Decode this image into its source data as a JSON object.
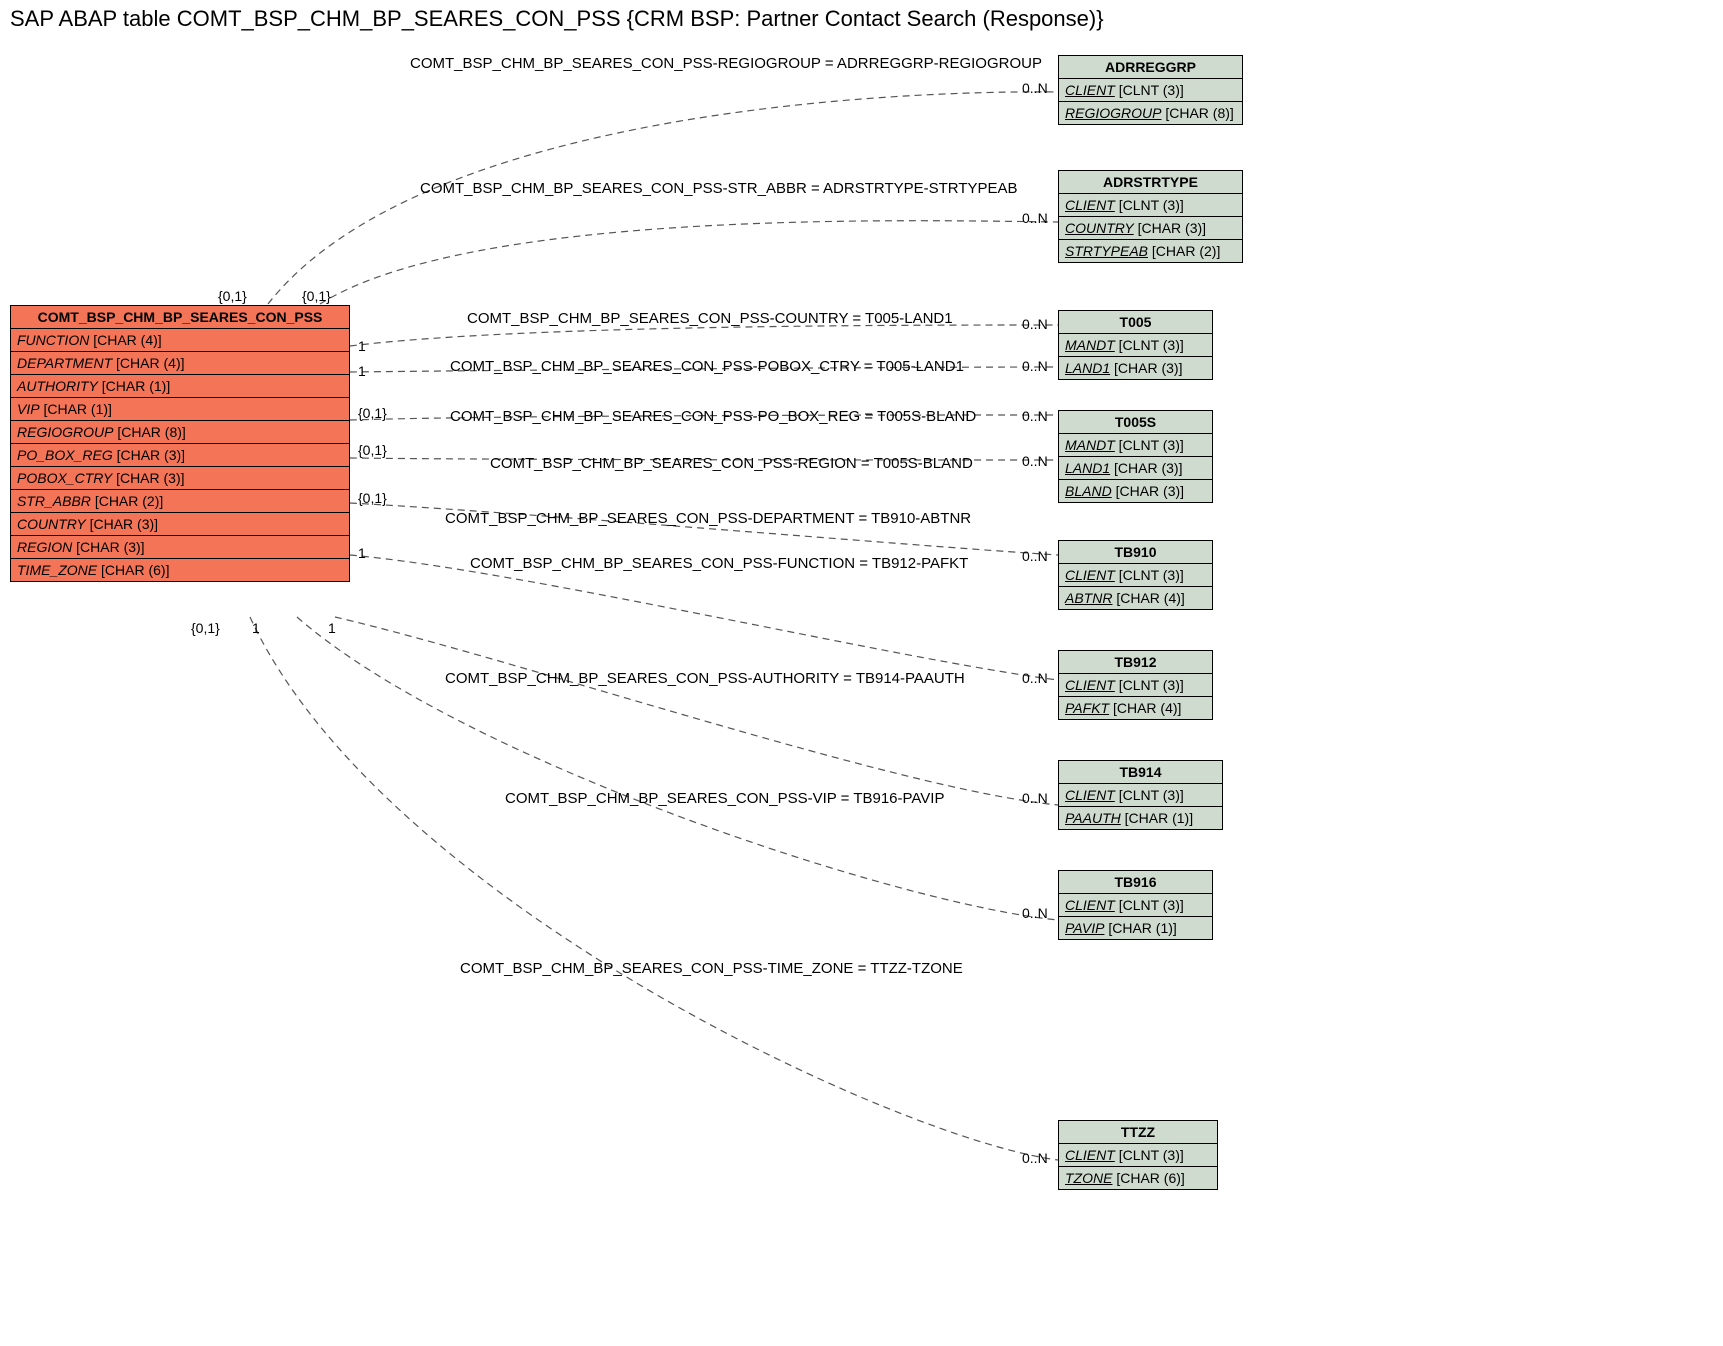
{
  "title": "SAP ABAP table COMT_BSP_CHM_BP_SEARES_CON_PSS {CRM BSP: Partner Contact Search (Response)}",
  "main_entity": {
    "name": "COMT_BSP_CHM_BP_SEARES_CON_PSS",
    "fields": [
      {
        "name": "FUNCTION",
        "type": "[CHAR (4)]"
      },
      {
        "name": "DEPARTMENT",
        "type": "[CHAR (4)]"
      },
      {
        "name": "AUTHORITY",
        "type": "[CHAR (1)]"
      },
      {
        "name": "VIP",
        "type": "[CHAR (1)]"
      },
      {
        "name": "REGIOGROUP",
        "type": "[CHAR (8)]"
      },
      {
        "name": "PO_BOX_REG",
        "type": "[CHAR (3)]"
      },
      {
        "name": "POBOX_CTRY",
        "type": "[CHAR (3)]"
      },
      {
        "name": "STR_ABBR",
        "type": "[CHAR (2)]"
      },
      {
        "name": "COUNTRY",
        "type": "[CHAR (3)]"
      },
      {
        "name": "REGION",
        "type": "[CHAR (3)]"
      },
      {
        "name": "TIME_ZONE",
        "type": "[CHAR (6)]"
      }
    ]
  },
  "target_entities": [
    {
      "id": "adrreggrp",
      "name": "ADRREGGRP",
      "fields": [
        {
          "name": "CLIENT",
          "type": "[CLNT (3)]",
          "ul": true
        },
        {
          "name": "REGIOGROUP",
          "type": "[CHAR (8)]",
          "ul": true
        }
      ]
    },
    {
      "id": "adrstrtype",
      "name": "ADRSTRTYPE",
      "fields": [
        {
          "name": "CLIENT",
          "type": "[CLNT (3)]",
          "ul": true
        },
        {
          "name": "COUNTRY",
          "type": "[CHAR (3)]",
          "ul": true
        },
        {
          "name": "STRTYPEAB",
          "type": "[CHAR (2)]",
          "ul": true
        }
      ]
    },
    {
      "id": "t005",
      "name": "T005",
      "fields": [
        {
          "name": "MANDT",
          "type": "[CLNT (3)]",
          "ul": true
        },
        {
          "name": "LAND1",
          "type": "[CHAR (3)]",
          "ul": true
        }
      ]
    },
    {
      "id": "t005s",
      "name": "T005S",
      "fields": [
        {
          "name": "MANDT",
          "type": "[CLNT (3)]",
          "ul": true
        },
        {
          "name": "LAND1",
          "type": "[CHAR (3)]",
          "ul": true
        },
        {
          "name": "BLAND",
          "type": "[CHAR (3)]",
          "ul": true
        }
      ]
    },
    {
      "id": "tb910",
      "name": "TB910",
      "fields": [
        {
          "name": "CLIENT",
          "type": "[CLNT (3)]",
          "ul": true
        },
        {
          "name": "ABTNR",
          "type": "[CHAR (4)]",
          "ul": true
        }
      ]
    },
    {
      "id": "tb912",
      "name": "TB912",
      "fields": [
        {
          "name": "CLIENT",
          "type": "[CLNT (3)]",
          "ul": true
        },
        {
          "name": "PAFKT",
          "type": "[CHAR (4)]",
          "ul": true
        }
      ]
    },
    {
      "id": "tb914",
      "name": "TB914",
      "fields": [
        {
          "name": "CLIENT",
          "type": "[CLNT (3)]",
          "ul": true
        },
        {
          "name": "PAAUTH",
          "type": "[CHAR (1)]",
          "ul": true
        }
      ]
    },
    {
      "id": "tb916",
      "name": "TB916",
      "fields": [
        {
          "name": "CLIENT",
          "type": "[CLNT (3)]",
          "ul": true
        },
        {
          "name": "PAVIP",
          "type": "[CHAR (1)]",
          "ul": true
        }
      ]
    },
    {
      "id": "ttzz",
      "name": "TTZZ",
      "fields": [
        {
          "name": "CLIENT",
          "type": "[CLNT (3)]",
          "ul": true
        },
        {
          "name": "TZONE",
          "type": "[CHAR (6)]",
          "ul": true
        }
      ]
    }
  ],
  "relations": [
    {
      "label": "COMT_BSP_CHM_BP_SEARES_CON_PSS-REGIOGROUP = ADRREGGRP-REGIOGROUP",
      "left_card": "{0,1}",
      "right_card": "0..N"
    },
    {
      "label": "COMT_BSP_CHM_BP_SEARES_CON_PSS-STR_ABBR = ADRSTRTYPE-STRTYPEAB",
      "left_card": "{0,1}",
      "right_card": "0..N"
    },
    {
      "label": "COMT_BSP_CHM_BP_SEARES_CON_PSS-COUNTRY = T005-LAND1",
      "left_card": "1",
      "right_card": "0..N"
    },
    {
      "label": "COMT_BSP_CHM_BP_SEARES_CON_PSS-POBOX_CTRY = T005-LAND1",
      "left_card": "1",
      "right_card": "0..N"
    },
    {
      "label": "COMT_BSP_CHM_BP_SEARES_CON_PSS-PO_BOX_REG = T005S-BLAND",
      "left_card": "{0,1}",
      "right_card": "0..N"
    },
    {
      "label": "COMT_BSP_CHM_BP_SEARES_CON_PSS-REGION = T005S-BLAND",
      "left_card": "{0,1}",
      "right_card": "0..N"
    },
    {
      "label": "COMT_BSP_CHM_BP_SEARES_CON_PSS-DEPARTMENT = TB910-ABTNR",
      "left_card": "{0,1}",
      "right_card": "0..N"
    },
    {
      "label": "COMT_BSP_CHM_BP_SEARES_CON_PSS-FUNCTION = TB912-PAFKT",
      "left_card": "1",
      "right_card": "0..N"
    },
    {
      "label": "COMT_BSP_CHM_BP_SEARES_CON_PSS-AUTHORITY = TB914-PAAUTH",
      "left_card": "1",
      "right_card": "0..N"
    },
    {
      "label": "COMT_BSP_CHM_BP_SEARES_CON_PSS-VIP = TB916-PAVIP",
      "left_card": "1",
      "right_card": "0..N"
    },
    {
      "label": "COMT_BSP_CHM_BP_SEARES_CON_PSS-TIME_ZONE = TTZZ-TZONE",
      "left_card": "{0,1}",
      "right_card": "0..N"
    }
  ]
}
